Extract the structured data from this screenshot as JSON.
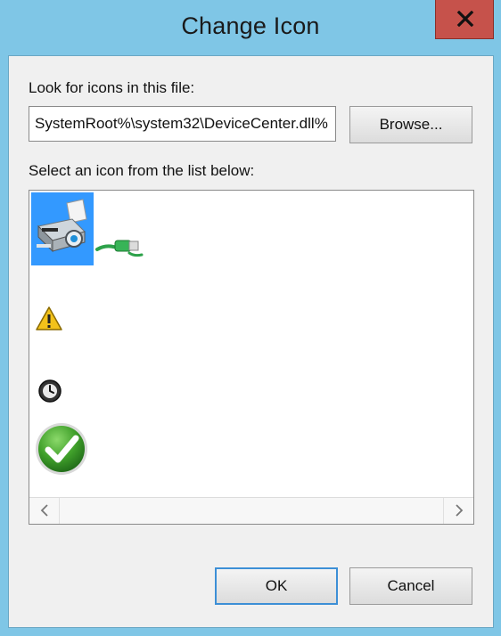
{
  "window": {
    "title": "Change Icon",
    "close_icon": "close-icon"
  },
  "file": {
    "label": "Look for icons in this file:",
    "path_value": "%SystemRoot%\\system32\\DeviceCenter.dll"
  },
  "browse_label": "Browse...",
  "list": {
    "label": "Select an icon from the list below:",
    "icons": [
      {
        "icon": "printer-scanner-icon",
        "selected": true
      },
      {
        "icon": "network-cable-icon",
        "selected": false
      },
      {
        "icon": "warning-icon",
        "selected": false
      },
      {
        "icon": "clock-icon",
        "selected": false
      },
      {
        "icon": "checkmark-icon",
        "selected": false
      }
    ],
    "scroll_left_icon": "chevron-left-icon",
    "scroll_right_icon": "chevron-right-icon"
  },
  "actions": {
    "ok_label": "OK",
    "cancel_label": "Cancel"
  },
  "colors": {
    "title_bar": "#7fc6e6",
    "close_button": "#c6524b",
    "selection": "#3399ff",
    "default_button_border": "#3c8fd6"
  }
}
